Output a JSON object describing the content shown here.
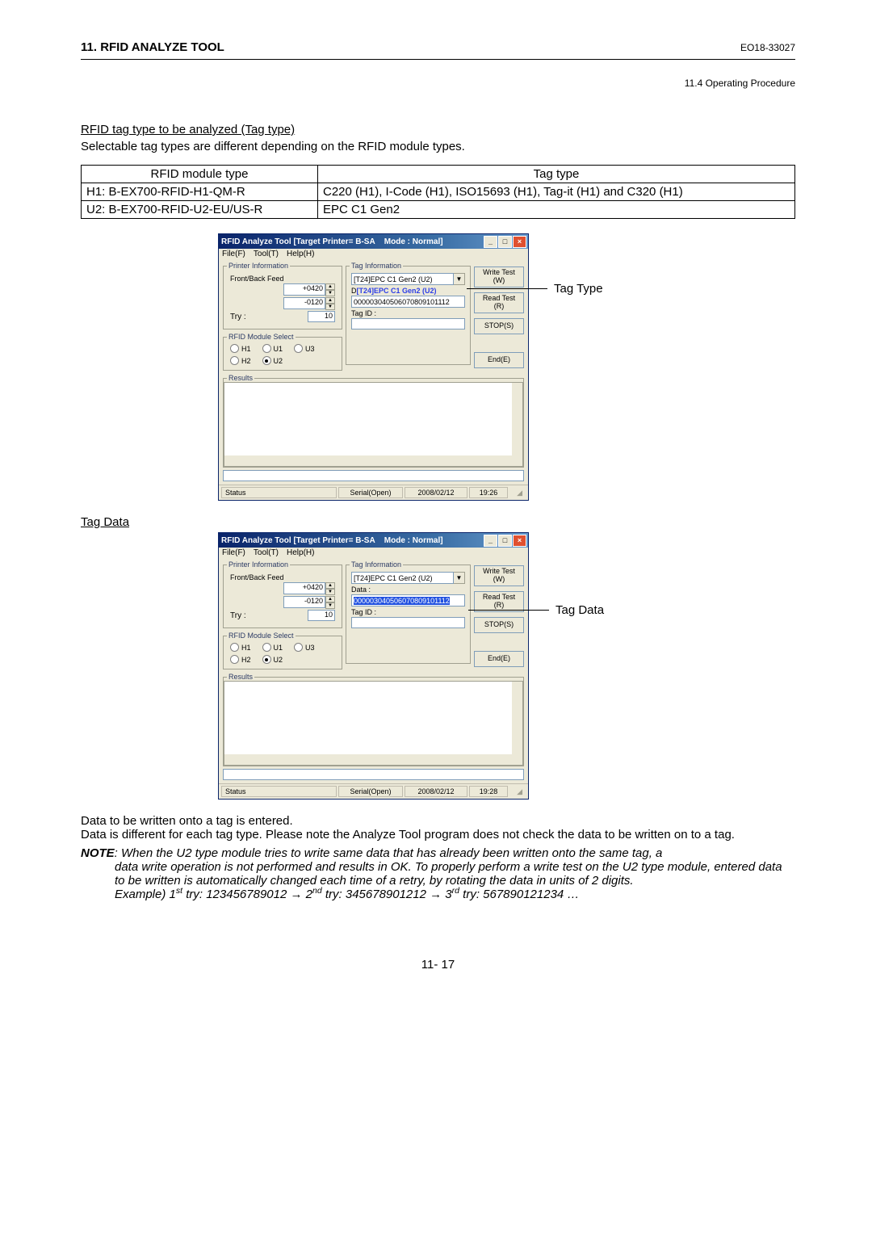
{
  "header": {
    "title": "11. RFID ANALYZE TOOL",
    "code": "EO18-33027",
    "subtitle": "11.4 Operating Procedure"
  },
  "section1": {
    "heading": "RFID tag type to be analyzed (Tag type)",
    "body": "Selectable tag types are different depending on the RFID module types."
  },
  "table": {
    "h1": "RFID module type",
    "h2": "Tag type",
    "r1c1": "H1: B-EX700-RFID-H1-QM-R",
    "r1c2": "C220 (H1), I-Code (H1), ISO15693 (H1), Tag-it (H1) and C320 (H1)",
    "r2c1": "U2: B-EX700-RFID-U2-EU/US-R",
    "r2c2": "EPC C1 Gen2"
  },
  "win_common": {
    "title_left": "RFID Analyze Tool [Target Printer= B-SA",
    "title_right": "Mode : Normal]",
    "menu_file": "File(F)",
    "menu_tool": "Tool(T)",
    "menu_help": "Help(H)",
    "printer_info": "Printer Information",
    "front_back": "Front/Back Feed",
    "front_val": "+0420",
    "back_val": "-0120",
    "try_lbl": "Try :",
    "try_val": "10",
    "rfid_sel": "RFID Module Select",
    "r_h1": "H1",
    "r_u1": "U1",
    "r_u3": "U3",
    "r_h2": "H2",
    "r_u2": "U2",
    "tag_info": "Tag Information",
    "combo_val": "[T24]EPC C1 Gen2 (U2)",
    "data_lbl": "Data :",
    "tag_id_lbl": "Tag ID :",
    "btn_write1": "Write Test",
    "btn_write2": "(W)",
    "btn_read1": "Read Test",
    "btn_read2": "(R)",
    "btn_stop": "STOP(S)",
    "btn_end": "End(E)",
    "results": "Results",
    "status": "Status",
    "serial": "Serial(Open)"
  },
  "win1": {
    "data_val_hl": "[T24]EPC C1 Gen2 (U2)",
    "data_val": "000003040506070809101112",
    "date": "2008/02/12",
    "time": "19:26"
  },
  "win2": {
    "data_val_sel": "000003040506070809101112",
    "date": "2008/02/12",
    "time": "19:28"
  },
  "callout1": "Tag Type",
  "callout2": "Tag Data",
  "sub_heading": "Tag Data",
  "tail": {
    "p1": "Data to be written onto a tag is entered.",
    "p2": "Data is different for each tag type.  Please note the Analyze Tool program does not check the data to be written on to a tag.",
    "note_lbl": "NOTE",
    "note1": ":  When the U2 type module tries to write same data that has already been written onto the same tag, a",
    "note2": "data write operation is not performed and results in OK.  To properly perform a write test on the U2 type module, entered data to be written is automatically changed each time of a retry, by rotating the data in units of 2 digits.",
    "ex": "Example) 1st try: 123456789012 → 2nd try: 345678901212 → 3rd try: 567890121234 …"
  },
  "page_num": "11- 17"
}
